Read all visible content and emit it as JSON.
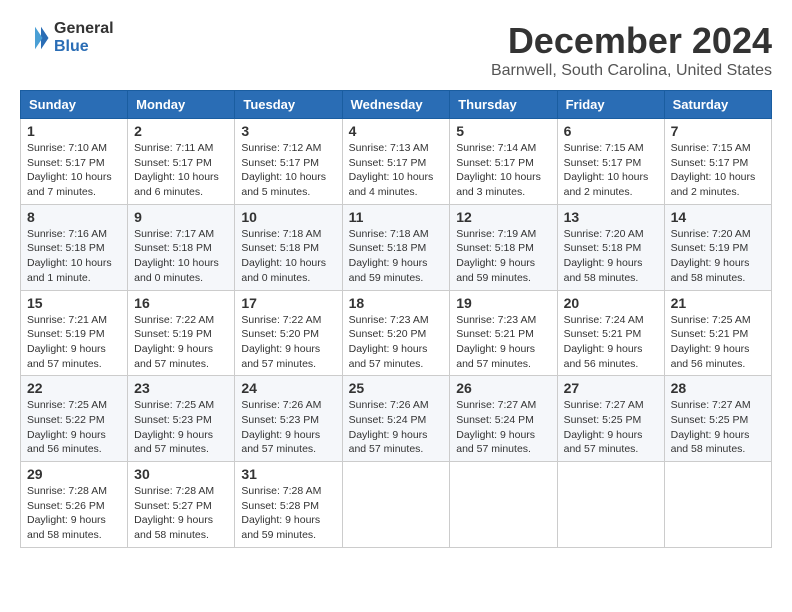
{
  "logo": {
    "general": "General",
    "blue": "Blue"
  },
  "title": "December 2024",
  "location": "Barnwell, South Carolina, United States",
  "days_of_week": [
    "Sunday",
    "Monday",
    "Tuesday",
    "Wednesday",
    "Thursday",
    "Friday",
    "Saturday"
  ],
  "weeks": [
    [
      {
        "day": "1",
        "sunrise": "7:10 AM",
        "sunset": "5:17 PM",
        "daylight": "10 hours and 7 minutes."
      },
      {
        "day": "2",
        "sunrise": "7:11 AM",
        "sunset": "5:17 PM",
        "daylight": "10 hours and 6 minutes."
      },
      {
        "day": "3",
        "sunrise": "7:12 AM",
        "sunset": "5:17 PM",
        "daylight": "10 hours and 5 minutes."
      },
      {
        "day": "4",
        "sunrise": "7:13 AM",
        "sunset": "5:17 PM",
        "daylight": "10 hours and 4 minutes."
      },
      {
        "day": "5",
        "sunrise": "7:14 AM",
        "sunset": "5:17 PM",
        "daylight": "10 hours and 3 minutes."
      },
      {
        "day": "6",
        "sunrise": "7:15 AM",
        "sunset": "5:17 PM",
        "daylight": "10 hours and 2 minutes."
      },
      {
        "day": "7",
        "sunrise": "7:15 AM",
        "sunset": "5:17 PM",
        "daylight": "10 hours and 2 minutes."
      }
    ],
    [
      {
        "day": "8",
        "sunrise": "7:16 AM",
        "sunset": "5:18 PM",
        "daylight": "10 hours and 1 minute."
      },
      {
        "day": "9",
        "sunrise": "7:17 AM",
        "sunset": "5:18 PM",
        "daylight": "10 hours and 0 minutes."
      },
      {
        "day": "10",
        "sunrise": "7:18 AM",
        "sunset": "5:18 PM",
        "daylight": "10 hours and 0 minutes."
      },
      {
        "day": "11",
        "sunrise": "7:18 AM",
        "sunset": "5:18 PM",
        "daylight": "9 hours and 59 minutes."
      },
      {
        "day": "12",
        "sunrise": "7:19 AM",
        "sunset": "5:18 PM",
        "daylight": "9 hours and 59 minutes."
      },
      {
        "day": "13",
        "sunrise": "7:20 AM",
        "sunset": "5:18 PM",
        "daylight": "9 hours and 58 minutes."
      },
      {
        "day": "14",
        "sunrise": "7:20 AM",
        "sunset": "5:19 PM",
        "daylight": "9 hours and 58 minutes."
      }
    ],
    [
      {
        "day": "15",
        "sunrise": "7:21 AM",
        "sunset": "5:19 PM",
        "daylight": "9 hours and 57 minutes."
      },
      {
        "day": "16",
        "sunrise": "7:22 AM",
        "sunset": "5:19 PM",
        "daylight": "9 hours and 57 minutes."
      },
      {
        "day": "17",
        "sunrise": "7:22 AM",
        "sunset": "5:20 PM",
        "daylight": "9 hours and 57 minutes."
      },
      {
        "day": "18",
        "sunrise": "7:23 AM",
        "sunset": "5:20 PM",
        "daylight": "9 hours and 57 minutes."
      },
      {
        "day": "19",
        "sunrise": "7:23 AM",
        "sunset": "5:21 PM",
        "daylight": "9 hours and 57 minutes."
      },
      {
        "day": "20",
        "sunrise": "7:24 AM",
        "sunset": "5:21 PM",
        "daylight": "9 hours and 56 minutes."
      },
      {
        "day": "21",
        "sunrise": "7:25 AM",
        "sunset": "5:21 PM",
        "daylight": "9 hours and 56 minutes."
      }
    ],
    [
      {
        "day": "22",
        "sunrise": "7:25 AM",
        "sunset": "5:22 PM",
        "daylight": "9 hours and 56 minutes."
      },
      {
        "day": "23",
        "sunrise": "7:25 AM",
        "sunset": "5:23 PM",
        "daylight": "9 hours and 57 minutes."
      },
      {
        "day": "24",
        "sunrise": "7:26 AM",
        "sunset": "5:23 PM",
        "daylight": "9 hours and 57 minutes."
      },
      {
        "day": "25",
        "sunrise": "7:26 AM",
        "sunset": "5:24 PM",
        "daylight": "9 hours and 57 minutes."
      },
      {
        "day": "26",
        "sunrise": "7:27 AM",
        "sunset": "5:24 PM",
        "daylight": "9 hours and 57 minutes."
      },
      {
        "day": "27",
        "sunrise": "7:27 AM",
        "sunset": "5:25 PM",
        "daylight": "9 hours and 57 minutes."
      },
      {
        "day": "28",
        "sunrise": "7:27 AM",
        "sunset": "5:25 PM",
        "daylight": "9 hours and 58 minutes."
      }
    ],
    [
      {
        "day": "29",
        "sunrise": "7:28 AM",
        "sunset": "5:26 PM",
        "daylight": "9 hours and 58 minutes."
      },
      {
        "day": "30",
        "sunrise": "7:28 AM",
        "sunset": "5:27 PM",
        "daylight": "9 hours and 58 minutes."
      },
      {
        "day": "31",
        "sunrise": "7:28 AM",
        "sunset": "5:28 PM",
        "daylight": "9 hours and 59 minutes."
      },
      null,
      null,
      null,
      null
    ]
  ],
  "labels": {
    "sunrise": "Sunrise:",
    "sunset": "Sunset:",
    "daylight": "Daylight:"
  }
}
